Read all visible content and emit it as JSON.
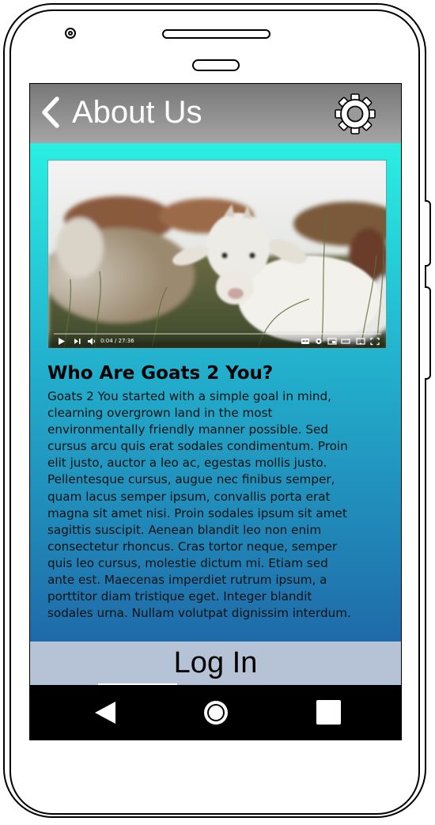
{
  "header": {
    "back_icon": "chevron-left-icon",
    "title": "About Us",
    "settings_icon": "gear-icon"
  },
  "video": {
    "time": "0:04 / 27:36",
    "progress": 0.0024
  },
  "article": {
    "heading": "Who Are Goats 2 You?",
    "body": "Goats 2 You started with a simple goal in mind,\nclearning overgrown land in the most\nenvironmentally friendly manner possible.  Sed\ncursus arcu quis erat sodales condimentum. Proin\nelit justo, auctor a leo ac, egestas mollis justo.\nPellentesque cursus, augue nec finibus semper,\nquam lacus semper ipsum, convallis porta erat\nmagna sit amet nisi. Proin sodales ipsum sit amet\nsagittis suscipit. Aenean blandit leo non enim\nconsectetur rhoncus. Cras tortor neque, semper\nquis leo cursus, molestie dictum mi. Etiam sed\nante est. Maecenas imperdiet rutrum ipsum, a\nporttitor diam tristique eget. Integer blandit\nsodales urna. Nullam volutpat dignissim interdum."
  },
  "footer": {
    "login_label": "Log In"
  },
  "navbar": {
    "icons": [
      "back-triangle-icon",
      "home-circle-icon",
      "recents-square-icon"
    ]
  },
  "colors": {
    "header_gray": "#8a8a8a",
    "content_top": "#2aefe2",
    "content_bottom": "#1f6aa8",
    "login_bg": "#b6c2d6",
    "navbar_bg": "#000000"
  }
}
